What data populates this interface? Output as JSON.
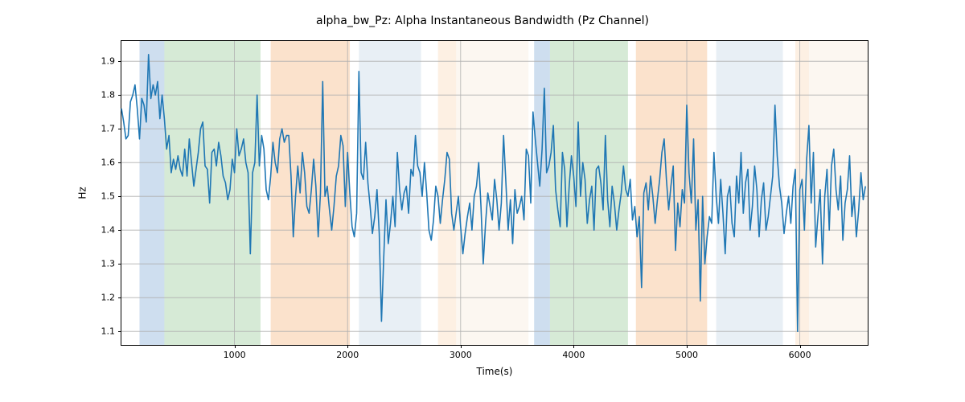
{
  "chart_data": {
    "type": "line",
    "title": "alpha_bw_Pz: Alpha Instantaneous Bandwidth (Pz Channel)",
    "xlabel": "Time(s)",
    "ylabel": "Hz",
    "xlim": [
      0,
      6600
    ],
    "ylim": [
      1.06,
      1.96
    ],
    "xticks": [
      1000,
      2000,
      3000,
      4000,
      5000,
      6000
    ],
    "yticks": [
      1.1,
      1.2,
      1.3,
      1.4,
      1.5,
      1.6,
      1.7,
      1.8,
      1.9
    ],
    "bands": [
      {
        "x0": 160,
        "x1": 380,
        "color": "#6699cc"
      },
      {
        "x0": 380,
        "x1": 1230,
        "color": "#7fbf7f"
      },
      {
        "x0": 1320,
        "x1": 2020,
        "color": "#f4a460"
      },
      {
        "x0": 2100,
        "x1": 2650,
        "color": "#b8cde0"
      },
      {
        "x0": 2800,
        "x1": 2960,
        "color": "#f8d0a8"
      },
      {
        "x0": 2960,
        "x1": 3600,
        "color": "#f5e5d5"
      },
      {
        "x0": 3650,
        "x1": 3790,
        "color": "#6699cc"
      },
      {
        "x0": 3790,
        "x1": 4480,
        "color": "#7fbf7f"
      },
      {
        "x0": 4550,
        "x1": 5180,
        "color": "#f4a460"
      },
      {
        "x0": 5260,
        "x1": 5850,
        "color": "#b8cde0"
      },
      {
        "x0": 5960,
        "x1": 6080,
        "color": "#f8d0a8"
      },
      {
        "x0": 6080,
        "x1": 6600,
        "color": "#f5e5d5"
      }
    ],
    "series": [
      {
        "name": "alpha_bw_Pz",
        "x_step": 20,
        "x_start": 0,
        "values": [
          1.76,
          1.72,
          1.67,
          1.68,
          1.78,
          1.8,
          1.83,
          1.76,
          1.67,
          1.79,
          1.77,
          1.72,
          1.92,
          1.79,
          1.83,
          1.8,
          1.84,
          1.73,
          1.8,
          1.73,
          1.64,
          1.68,
          1.57,
          1.61,
          1.58,
          1.62,
          1.58,
          1.56,
          1.64,
          1.56,
          1.67,
          1.6,
          1.53,
          1.58,
          1.63,
          1.7,
          1.72,
          1.59,
          1.58,
          1.48,
          1.63,
          1.64,
          1.59,
          1.66,
          1.62,
          1.56,
          1.54,
          1.49,
          1.52,
          1.61,
          1.57,
          1.7,
          1.62,
          1.64,
          1.67,
          1.6,
          1.57,
          1.33,
          1.57,
          1.6,
          1.8,
          1.59,
          1.68,
          1.64,
          1.52,
          1.49,
          1.56,
          1.66,
          1.6,
          1.57,
          1.67,
          1.7,
          1.66,
          1.68,
          1.68,
          1.56,
          1.38,
          1.5,
          1.59,
          1.51,
          1.63,
          1.57,
          1.47,
          1.45,
          1.52,
          1.61,
          1.53,
          1.38,
          1.51,
          1.84,
          1.5,
          1.53,
          1.46,
          1.4,
          1.47,
          1.56,
          1.59,
          1.68,
          1.65,
          1.47,
          1.63,
          1.51,
          1.41,
          1.38,
          1.45,
          1.87,
          1.57,
          1.55,
          1.66,
          1.54,
          1.47,
          1.39,
          1.44,
          1.52,
          1.39,
          1.13,
          1.32,
          1.49,
          1.36,
          1.42,
          1.5,
          1.41,
          1.63,
          1.52,
          1.46,
          1.51,
          1.53,
          1.45,
          1.58,
          1.56,
          1.68,
          1.59,
          1.57,
          1.5,
          1.6,
          1.51,
          1.4,
          1.37,
          1.43,
          1.53,
          1.5,
          1.42,
          1.49,
          1.55,
          1.63,
          1.61,
          1.45,
          1.4,
          1.45,
          1.5,
          1.41,
          1.33,
          1.39,
          1.44,
          1.48,
          1.4,
          1.5,
          1.53,
          1.6,
          1.47,
          1.3,
          1.42,
          1.51,
          1.47,
          1.43,
          1.55,
          1.49,
          1.4,
          1.48,
          1.68,
          1.54,
          1.4,
          1.49,
          1.36,
          1.52,
          1.45,
          1.47,
          1.5,
          1.43,
          1.64,
          1.62,
          1.48,
          1.75,
          1.67,
          1.6,
          1.53,
          1.64,
          1.82,
          1.57,
          1.59,
          1.63,
          1.71,
          1.52,
          1.46,
          1.41,
          1.63,
          1.58,
          1.41,
          1.53,
          1.62,
          1.56,
          1.47,
          1.72,
          1.5,
          1.6,
          1.55,
          1.42,
          1.49,
          1.53,
          1.4,
          1.58,
          1.59,
          1.54,
          1.46,
          1.68,
          1.49,
          1.41,
          1.53,
          1.48,
          1.4,
          1.46,
          1.51,
          1.59,
          1.52,
          1.5,
          1.55,
          1.43,
          1.47,
          1.38,
          1.44,
          1.23,
          1.51,
          1.54,
          1.46,
          1.56,
          1.5,
          1.42,
          1.49,
          1.55,
          1.63,
          1.67,
          1.55,
          1.46,
          1.53,
          1.59,
          1.34,
          1.48,
          1.41,
          1.52,
          1.48,
          1.77,
          1.57,
          1.48,
          1.67,
          1.4,
          1.49,
          1.19,
          1.5,
          1.3,
          1.38,
          1.44,
          1.42,
          1.63,
          1.5,
          1.42,
          1.55,
          1.45,
          1.33,
          1.5,
          1.53,
          1.42,
          1.38,
          1.56,
          1.48,
          1.63,
          1.45,
          1.54,
          1.58,
          1.4,
          1.47,
          1.59,
          1.52,
          1.38,
          1.49,
          1.54,
          1.4,
          1.44,
          1.5,
          1.56,
          1.77,
          1.62,
          1.53,
          1.48,
          1.39,
          1.45,
          1.5,
          1.42,
          1.53,
          1.58,
          1.1,
          1.52,
          1.55,
          1.4,
          1.61,
          1.71,
          1.48,
          1.63,
          1.35,
          1.44,
          1.52,
          1.3,
          1.5,
          1.58,
          1.4,
          1.59,
          1.64,
          1.52,
          1.46,
          1.56,
          1.37,
          1.48,
          1.52,
          1.62,
          1.44,
          1.5,
          1.38,
          1.46,
          1.57,
          1.49,
          1.53
        ]
      }
    ]
  }
}
